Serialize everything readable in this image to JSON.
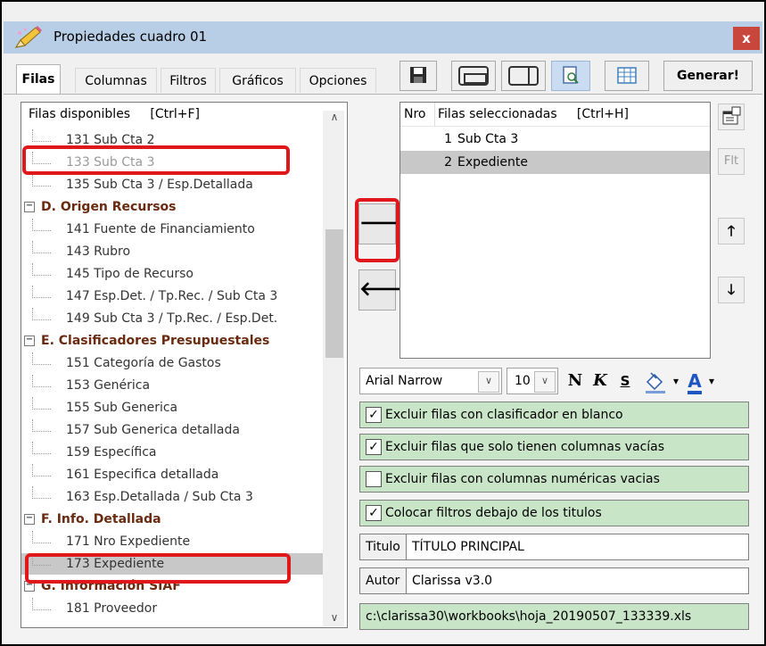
{
  "window": {
    "title": "Propiedades cuadro 01",
    "close_label": "x"
  },
  "tabs": [
    {
      "label": "Filas",
      "active": true
    },
    {
      "label": "Columnas",
      "active": false
    },
    {
      "label": "Filtros",
      "active": false
    },
    {
      "label": "Gráficos",
      "active": false
    },
    {
      "label": "Opciones",
      "active": false
    }
  ],
  "toolbar": {
    "icons": [
      "save-icon",
      "window-layout-icon",
      "split-view-icon",
      "preview-icon",
      "table-icon"
    ],
    "generate_label": "Generar!"
  },
  "tree": {
    "header": "Filas disponibles     [Ctrl+F]",
    "items": [
      {
        "type": "leaf",
        "label": "131 Sub Cta 2"
      },
      {
        "type": "leaf",
        "label": "133 Sub Cta 3",
        "disabled": true
      },
      {
        "type": "leaf",
        "label": "135 Sub Cta 3 / Esp.Detallada"
      },
      {
        "type": "group",
        "label": "D. Origen Recursos"
      },
      {
        "type": "leaf",
        "label": "141 Fuente de Financiamiento"
      },
      {
        "type": "leaf",
        "label": "143 Rubro"
      },
      {
        "type": "leaf",
        "label": "145 Tipo de Recurso"
      },
      {
        "type": "leaf",
        "label": "147 Esp.Det. / Tp.Rec. / Sub Cta 3"
      },
      {
        "type": "leaf",
        "label": "149 Sub Cta 3 / Tp.Rec. / Esp.Det."
      },
      {
        "type": "group",
        "label": "E. Clasificadores Presupuestales"
      },
      {
        "type": "leaf",
        "label": "151 Categoría de Gastos"
      },
      {
        "type": "leaf",
        "label": "153 Genérica"
      },
      {
        "type": "leaf",
        "label": "155 Sub Generica"
      },
      {
        "type": "leaf",
        "label": "157 Sub Generica detallada"
      },
      {
        "type": "leaf",
        "label": "159 Específica"
      },
      {
        "type": "leaf",
        "label": "161 Especifica detallada"
      },
      {
        "type": "leaf",
        "label": "163 Esp.Detallada / Sub Cta 3"
      },
      {
        "type": "group",
        "label": "F. Info. Detallada"
      },
      {
        "type": "leaf",
        "label": "171 Nro Expediente"
      },
      {
        "type": "leaf",
        "label": "173 Expediente",
        "selected": true
      },
      {
        "type": "group",
        "label": "G. Información SIAF"
      },
      {
        "type": "leaf",
        "label": "181 Proveedor"
      }
    ]
  },
  "move": {
    "add_arrow": "🡒",
    "remove_arrow": "🡐"
  },
  "selected": {
    "col_nro": "Nro",
    "col_label": "Filas seleccionadas     [Ctrl+H]",
    "rows": [
      {
        "nro": "1",
        "label": "Sub Cta 3",
        "selected": false
      },
      {
        "nro": "2",
        "label": "Expediente",
        "selected": true
      }
    ]
  },
  "side_buttons": {
    "properties_icon": "properties-icon",
    "filter_label": "Flt",
    "up_arrow": "🡑",
    "down_arrow": "🡓"
  },
  "format": {
    "font": "Arial Narrow",
    "size": "10",
    "bold": "N",
    "italic": "K",
    "underline": "S",
    "fill_dropdown": "▾",
    "text_color_label": "A",
    "text_color_dropdown": "▾"
  },
  "options": [
    {
      "label": "Excluir filas con clasificador en blanco",
      "checked": true
    },
    {
      "label": "Excluir filas que solo tienen columnas vacías",
      "checked": true
    },
    {
      "label": "Excluir filas con columnas numéricas vacias",
      "checked": false
    },
    {
      "label": "Colocar filtros debajo de los titulos",
      "checked": true
    }
  ],
  "fields": {
    "titulo_label": "Titulo",
    "titulo_value": "TÍTULO PRINCIPAL",
    "autor_label": "Autor",
    "autor_value": "Clarissa v3.0",
    "path": "c:\\clarissa30\\workbooks\\hoja_20190507_133339.xls"
  },
  "colors": {
    "highlight": "#e0181b",
    "option_bg": "#c9e5c8",
    "titlebar": "#b8cde6",
    "group_text": "#6a2a10"
  }
}
